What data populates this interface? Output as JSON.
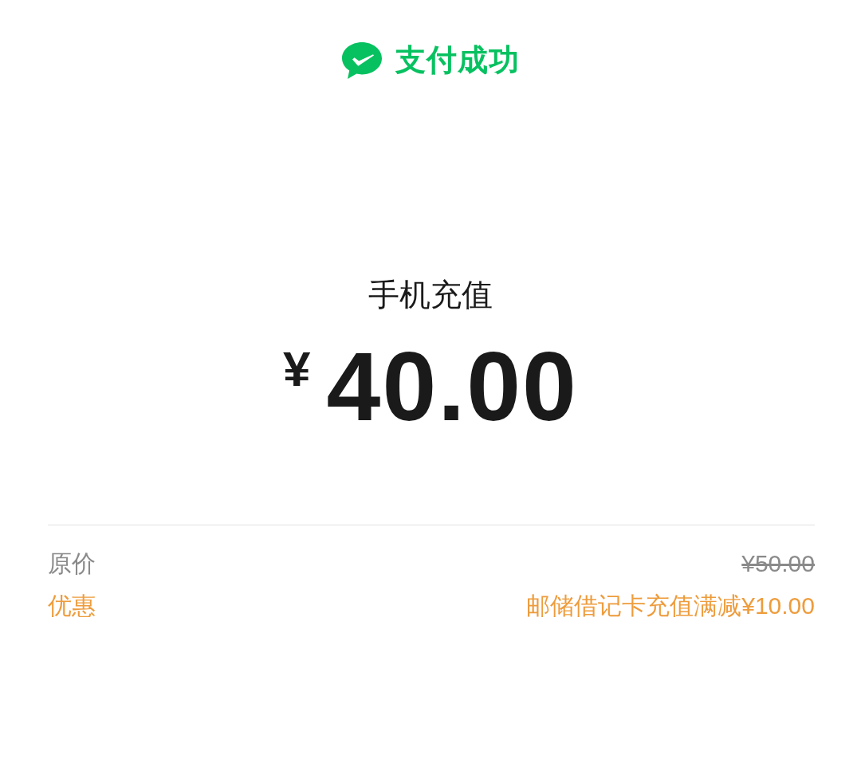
{
  "header": {
    "title": "支付成功"
  },
  "payment": {
    "merchant": "手机充值",
    "currency": "¥",
    "amount": "40.00"
  },
  "details": [
    {
      "kind": "original",
      "label": "原价",
      "value": "¥50.00",
      "struck": true
    },
    {
      "kind": "discount",
      "label": "优惠",
      "value": "邮储借记卡充值满减¥10.00",
      "struck": false
    }
  ]
}
